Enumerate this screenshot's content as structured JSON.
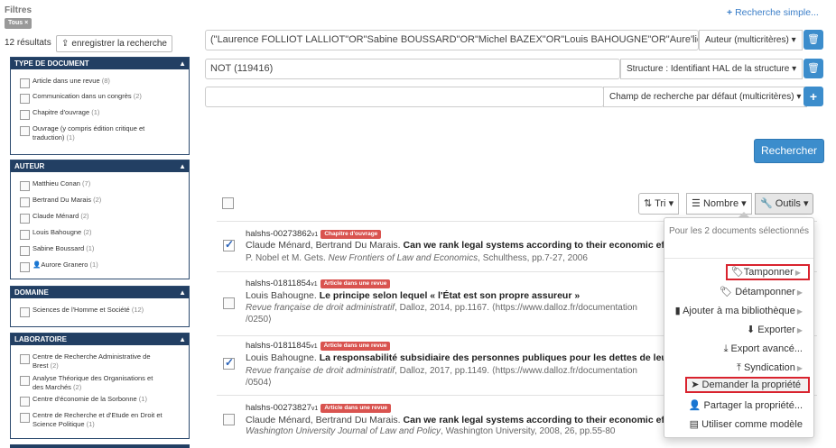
{
  "filters": {
    "title": "Filtres",
    "chip": "Tous ×",
    "results": "12 résultats",
    "save_label": "enregistrer la recherche"
  },
  "facets": [
    {
      "title": "TYPE DE DOCUMENT",
      "items": [
        {
          "label": "Article dans une revue",
          "count": "(8)"
        },
        {
          "label": "Communication dans un congrès",
          "count": "(2)"
        },
        {
          "label": "Chapitre d'ouvrage",
          "count": "(1)"
        },
        {
          "label": "Ouvrage (y compris édition critique et traduction)",
          "count": "(1)"
        }
      ]
    },
    {
      "title": "AUTEUR",
      "items": [
        {
          "label": "Matthieu Conan",
          "count": "(7)"
        },
        {
          "label": "Bertrand Du Marais",
          "count": "(2)"
        },
        {
          "label": "Claude Ménard",
          "count": "(2)"
        },
        {
          "label": "Louis Bahougne",
          "count": "(2)"
        },
        {
          "label": "Sabine Boussard",
          "count": "(1)"
        },
        {
          "label": "Aurore Granero",
          "count": "(1)"
        }
      ]
    },
    {
      "title": "DOMAINE",
      "items": [
        {
          "label": "Sciences de l'Homme et Société",
          "count": "(12)"
        }
      ]
    },
    {
      "title": "LABORATOIRE",
      "items": [
        {
          "label": "Centre de Recherche Administrative de Brest",
          "count": "(2)"
        },
        {
          "label": "Analyse Théorique des Organisations et des Marchés",
          "count": "(2)"
        },
        {
          "label": "Centre d'économie de la Sorbonne",
          "count": "(1)"
        },
        {
          "label": "Centre de Recherche et d'Etude en Droit et Science Politique",
          "count": "(1)"
        }
      ]
    }
  ],
  "search": {
    "simple_link": "Recherche simple...",
    "rows": [
      {
        "value": "(\"Laurence FOLLIOT LALLIOT\"OR\"Sabine BOUSSARD\"OR\"Michel BAZEX\"OR\"Louis BAHOUGNE\"OR\"Aure'lien C",
        "select": "Auteur (multicritères)"
      },
      {
        "value": "NOT (119416)",
        "select": "Structure : Identifiant HAL de la structure"
      },
      {
        "value": "",
        "select": "Champ de recherche par défaut (multicritères)"
      }
    ],
    "submit": "Rechercher"
  },
  "toolbar": {
    "sort": "Tri",
    "number": "Nombre",
    "tools": "Outils"
  },
  "docs": [
    {
      "id": "halshs-00273862",
      "version": "v1",
      "badge": "Chapitre d'ouvrage",
      "checked": true,
      "authors": "Claude Ménard, Bertrand Du Marais.",
      "title": "Can we rank legal systems according to their economic eff",
      "src_pre": "P. Nobel et M. Gets.",
      "src_it": "New Frontiers of Law and Economics",
      "src_post": ", Schulthess, pp.7-27, 2006",
      "src2": ""
    },
    {
      "id": "halshs-01811854",
      "version": "v1",
      "badge": "Article dans une revue",
      "checked": false,
      "authors": "Louis Bahougne.",
      "title": "Le principe selon lequel « l'État est son propre assureur »",
      "src_pre": "",
      "src_it": "Revue française de droit administratif",
      "src_post": ", Dalloz, 2014, pp.1167. ⟨https://www.dalloz.fr/documentation",
      "src2": "/0250⟩"
    },
    {
      "id": "halshs-01811845",
      "version": "v1",
      "badge": "Article dans une revue",
      "checked": true,
      "authors": "Louis Bahougne.",
      "title": "La responsabilité subsidiaire des personnes publiques pour les dettes de leur",
      "src_pre": "",
      "src_it": "Revue française de droit administratif",
      "src_post": ", Dalloz, 2017, pp.1149. ⟨https://www.dalloz.fr/documentation",
      "src2": "/0504⟩"
    },
    {
      "id": "halshs-00273827",
      "version": "v1",
      "badge": "Article dans une revue",
      "checked": false,
      "authors": "Claude Ménard, Bertrand Du Marais.",
      "title": "Can we rank legal systems according to their economic eff",
      "src_pre": "",
      "src_it": "Washington University Journal of Law and Policy",
      "src_post": ", Washington University, 2008, 26, pp.55-80",
      "src2": ""
    }
  ],
  "menu": {
    "header": "Pour les 2 documents sélectionnés",
    "items": [
      {
        "label": "Tamponner",
        "icon": "tags-icon",
        "submenu": true
      },
      {
        "label": "Détamponner",
        "icon": "tag-icon",
        "submenu": true
      },
      {
        "label": "Ajouter à ma bibliothèque",
        "icon": "book-icon",
        "submenu": true
      },
      {
        "label": "Exporter",
        "icon": "download-icon",
        "submenu": true
      },
      {
        "label": "Export avancé...",
        "icon": "export-icon",
        "submenu": false
      },
      {
        "label": "Syndication",
        "icon": "upload-icon",
        "submenu": true
      },
      {
        "label": "Demander la propriété",
        "icon": "send-icon",
        "submenu": false
      },
      {
        "label": "Partager la propriété...",
        "icon": "user-icon",
        "submenu": false
      },
      {
        "label": "Utiliser comme modèle",
        "icon": "file-icon",
        "submenu": false
      }
    ]
  },
  "colors": {
    "accent": "#3c8dcc",
    "panel_header": "#223f63",
    "badge": "#d9534f",
    "highlight": "#d9232e"
  }
}
